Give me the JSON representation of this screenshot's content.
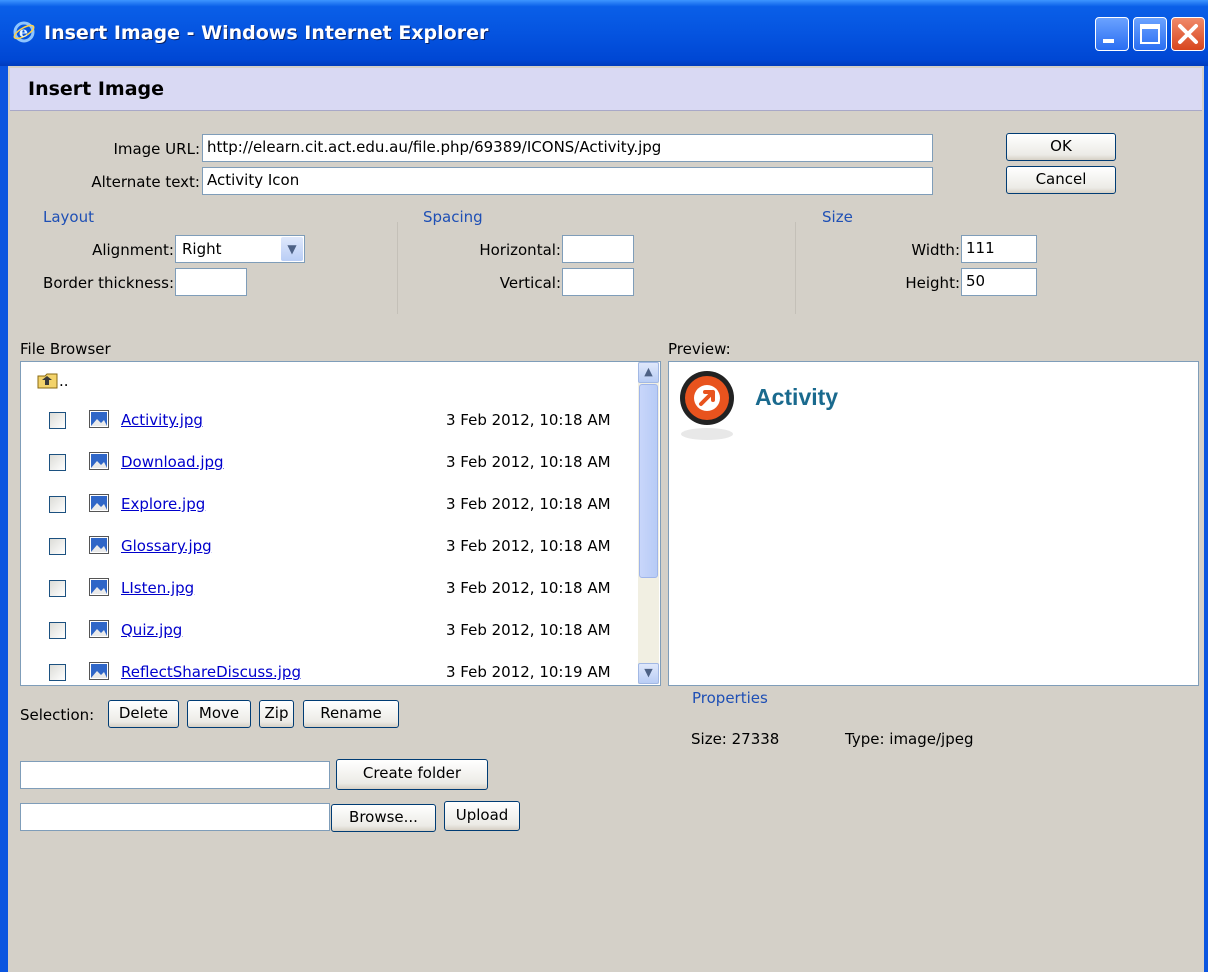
{
  "window": {
    "title": "Insert Image - Windows Internet Explorer"
  },
  "dialog": {
    "title": "Insert Image"
  },
  "form": {
    "image_url_label": "Image URL:",
    "image_url_value": "http://elearn.cit.act.edu.au/file.php/69389/ICONS/Activity.jpg",
    "alt_text_label": "Alternate text:",
    "alt_text_value": "Activity Icon",
    "ok_label": "OK",
    "cancel_label": "Cancel"
  },
  "layout": {
    "section_label": "Layout",
    "alignment_label": "Alignment:",
    "alignment_value": "Right",
    "border_label": "Border thickness:",
    "border_value": ""
  },
  "spacing": {
    "section_label": "Spacing",
    "horizontal_label": "Horizontal:",
    "horizontal_value": "",
    "vertical_label": "Vertical:",
    "vertical_value": ""
  },
  "size": {
    "section_label": "Size",
    "width_label": "Width:",
    "width_value": "111",
    "height_label": "Height:",
    "height_value": "50"
  },
  "browser": {
    "label": "File Browser",
    "parent_label": "..",
    "files": [
      {
        "name": "Activity.jpg",
        "date": "3 Feb 2012, 10:18 AM"
      },
      {
        "name": "Download.jpg",
        "date": "3 Feb 2012, 10:18 AM"
      },
      {
        "name": "Explore.jpg",
        "date": "3 Feb 2012, 10:18 AM"
      },
      {
        "name": "Glossary.jpg",
        "date": "3 Feb 2012, 10:18 AM"
      },
      {
        "name": "LIsten.jpg",
        "date": "3 Feb 2012, 10:18 AM"
      },
      {
        "name": "Quiz.jpg",
        "date": "3 Feb 2012, 10:18 AM"
      },
      {
        "name": "ReflectShareDiscuss.jpg",
        "date": "3 Feb 2012, 10:19 AM"
      }
    ]
  },
  "preview": {
    "label": "Preview:",
    "image_text": "Activity"
  },
  "properties": {
    "label": "Properties",
    "size_text": "Size: 27338",
    "type_text": "Type: image/jpeg"
  },
  "selection": {
    "label": "Selection:",
    "delete_label": "Delete",
    "move_label": "Move",
    "zip_label": "Zip",
    "rename_label": "Rename"
  },
  "folder": {
    "create_value": "",
    "create_label": "Create folder"
  },
  "upload": {
    "file_value": "",
    "browse_label": "Browse...",
    "upload_label": "Upload"
  },
  "colors": {
    "titlebar": "#0554e0",
    "section_heading": "#1e4fb5",
    "link": "#0000cc",
    "header_band": "#d9d9f3"
  }
}
